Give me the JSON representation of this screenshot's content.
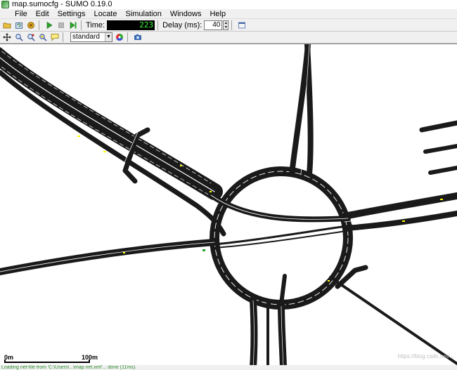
{
  "window": {
    "title": "map.sumocfg - SUMO 0.19.0"
  },
  "menu": [
    {
      "label": "File",
      "key": "F"
    },
    {
      "label": "Edit",
      "key": "E"
    },
    {
      "label": "Settings",
      "key": "S"
    },
    {
      "label": "Locate",
      "key": "L"
    },
    {
      "label": "Simulation",
      "key": ""
    },
    {
      "label": "Windows",
      "key": "W"
    },
    {
      "label": "Help",
      "key": "H"
    }
  ],
  "toolbar": {
    "time_label": "Time:",
    "time_value": "223",
    "delay_label": "Delay (ms):",
    "delay_value": "40",
    "icons": [
      "open-icon",
      "reload-icon",
      "close-sim-icon",
      "run-icon",
      "stop-icon",
      "step-icon",
      "time-toggle-icon"
    ]
  },
  "view_toolbar": {
    "scheme": "standard",
    "icons": [
      "recenter-icon",
      "locate-junction-icon",
      "locate-edge-icon",
      "locate-vehicle-icon",
      "tooltips-icon",
      "color-wheel-icon",
      "screenshot-icon"
    ]
  },
  "scale": {
    "left": "0m",
    "right": "100m"
  },
  "status": {
    "text": "Loading net-file from 'C:\\Users\\...\\map.net.xml'... done (11ms)."
  },
  "watermark": "https://blog.csdn.net/...",
  "colors": {
    "road": "#1a1a1a",
    "lane_line": "#ffffff",
    "vehicle": "#ffff00",
    "time_digits": "#39ff39"
  }
}
